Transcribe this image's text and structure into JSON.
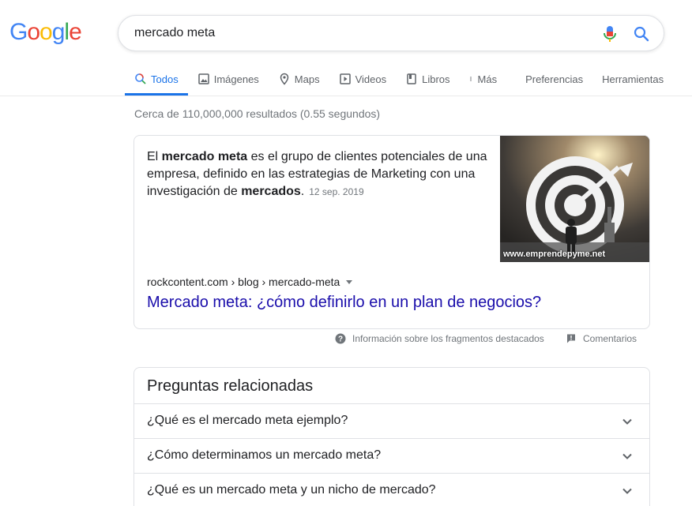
{
  "logo": {
    "letters": [
      "G",
      "o",
      "o",
      "g",
      "l",
      "e"
    ],
    "colors": [
      "#4285F4",
      "#EA4335",
      "#FBBC05",
      "#4285F4",
      "#34A853",
      "#EA4335"
    ]
  },
  "search": {
    "value": "mercado meta"
  },
  "tabs": [
    {
      "label": "Todos",
      "icon": "search-icon",
      "active": true
    },
    {
      "label": "Imágenes",
      "icon": "image-icon"
    },
    {
      "label": "Maps",
      "icon": "map-pin-icon"
    },
    {
      "label": "Videos",
      "icon": "play-icon"
    },
    {
      "label": "Libros",
      "icon": "book-icon"
    },
    {
      "label": "Más",
      "icon": "more-vert-icon"
    },
    {
      "label": "Preferencias"
    },
    {
      "label": "Herramientas"
    }
  ],
  "stats": "Cerca de 110,000,000 resultados (0.55 segundos)",
  "featured": {
    "snippet_parts": [
      "El ",
      "mercado meta",
      " es el grupo de clientes potenciales de una empresa, definido en las estrategias de Marketing con una investigación de ",
      "mercados",
      "."
    ],
    "date": "12 sep. 2019",
    "image_caption": "www.emprendepyme.net",
    "cite": "rockcontent.com › blog › mercado-meta",
    "title": "Mercado meta: ¿cómo definirlo en un plan de negocios?"
  },
  "feedback": {
    "about": "Información sobre los fragmentos destacados",
    "comments": "Comentarios"
  },
  "paa": {
    "title": "Preguntas relacionadas",
    "questions": [
      "¿Qué es el mercado meta ejemplo?",
      "¿Cómo determinamos un mercado meta?",
      "¿Qué es un mercado meta y un nicho de mercado?"
    ]
  },
  "colors": {
    "link": "#1a0dab",
    "accent": "#1a73e8",
    "muted": "#70757a"
  }
}
